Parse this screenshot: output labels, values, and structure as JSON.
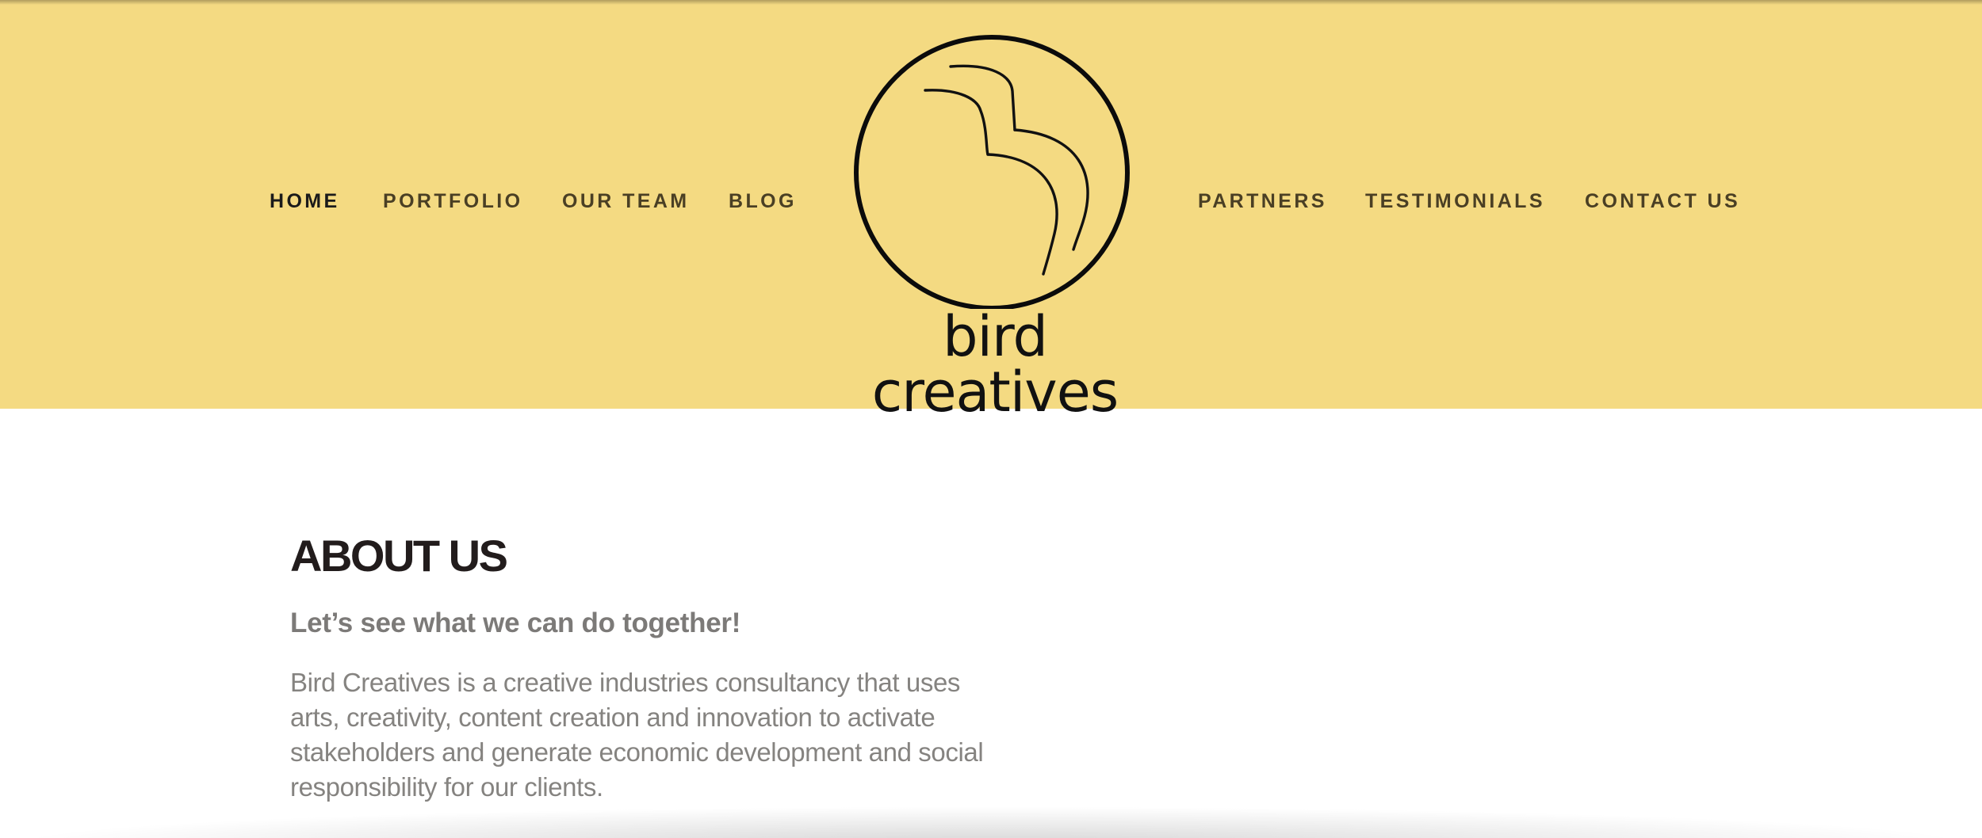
{
  "colors": {
    "header_background": "#f4da82",
    "nav_text": "#4a3f24",
    "nav_active_text": "#1a1a1a",
    "heading": "#221c1c",
    "body_text": "#858380"
  },
  "header": {
    "nav_left": [
      {
        "label": "HOME",
        "active": true
      },
      {
        "label": "PORTFOLIO",
        "active": false
      },
      {
        "label": "OUR TEAM",
        "active": false
      },
      {
        "label": "BLOG",
        "active": false
      }
    ],
    "logo": {
      "icon": "bird-circle-logo",
      "text": "bird creatives"
    },
    "nav_right": [
      {
        "label": "PARTNERS",
        "active": false
      },
      {
        "label": "TESTIMONIALS",
        "active": false
      },
      {
        "label": "CONTACT US",
        "active": false
      }
    ]
  },
  "about": {
    "title": "ABOUT US",
    "subtitle": "Let’s see what we can do together!",
    "body": "Bird Creatives is a creative industries consultancy that uses arts, creativity, content creation and innovation to activate stakeholders and generate economic development and social responsibility for our clients."
  }
}
